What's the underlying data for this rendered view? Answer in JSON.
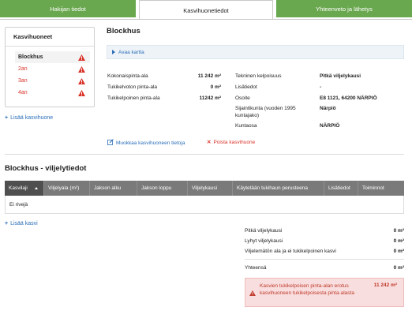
{
  "tabs": [
    {
      "label": "Hakijan tiedot"
    },
    {
      "label": "Kasvihuonetiedot"
    },
    {
      "label": "Yhteenveto ja lähetys"
    }
  ],
  "sidebar": {
    "title": "Kasvihuoneet",
    "items": [
      {
        "label": "Blockhus"
      },
      {
        "label": "2an"
      },
      {
        "label": "3an"
      },
      {
        "label": "4an"
      }
    ],
    "add_label": "Lisää kasvihuone"
  },
  "main": {
    "title": "Blockhus",
    "map_label": "Avaa kartta",
    "left": [
      {
        "label": "Kokonaispinta-ala",
        "value": "11 242 m²"
      },
      {
        "label": "Tukikelvoton pinta-ala",
        "value": "0 m²"
      },
      {
        "label": "Tukikelpoinen pinta-ala",
        "value": "11242 m²"
      }
    ],
    "right": [
      {
        "label": "Tekninen kelpoisuus",
        "value": "Pitkä viljelykausi"
      },
      {
        "label": "Lisätiedot",
        "value": "-"
      },
      {
        "label": "Osoite",
        "value": "E8 1121, 64200 NÄRPIÖ"
      },
      {
        "label": "Sijaintikunta (vuoden 1995 kuntajako)",
        "value": "Närpiö"
      },
      {
        "label": "Kuntaosa",
        "value": "NÄRPIÖ"
      }
    ],
    "edit_label": "Muokkaa kasvihuoneen tietoja",
    "delete_label": "Poista kasvihuone"
  },
  "cultivation": {
    "title": "Blockhus - viljelytiedot",
    "columns": [
      "Kasvilaji",
      "Viljelyala (m²)",
      "Jakson alku",
      "Jakson loppu",
      "Viljelykausi",
      "Käytetään tukihaun perusteena",
      "Lisätiedot",
      "Toiminnot"
    ],
    "empty_text": "Ei rivejä",
    "add_label": "Lisää kasvi"
  },
  "summary": {
    "rows": [
      {
        "label": "Pitkä viljelykausi",
        "value": "0 m²"
      },
      {
        "label": "Lyhyt viljelykausi",
        "value": "0 m²"
      },
      {
        "label": "Viljelemätön ala ja ei tukikelpoinen kasvi",
        "value": "0 m²"
      }
    ],
    "total_label": "Yhteensä",
    "total_value": "0 m²",
    "alert_text": "Kasvien tukikelpoisen pinta-alan erotus kasvihuoneen tukikelpoisesta pinta-alasta",
    "alert_value": "11 242 m²"
  },
  "colors": {
    "green": "#6aa84f",
    "link": "#2a6eb8",
    "error": "#d9342b",
    "table_header": "#7a7a7a"
  }
}
